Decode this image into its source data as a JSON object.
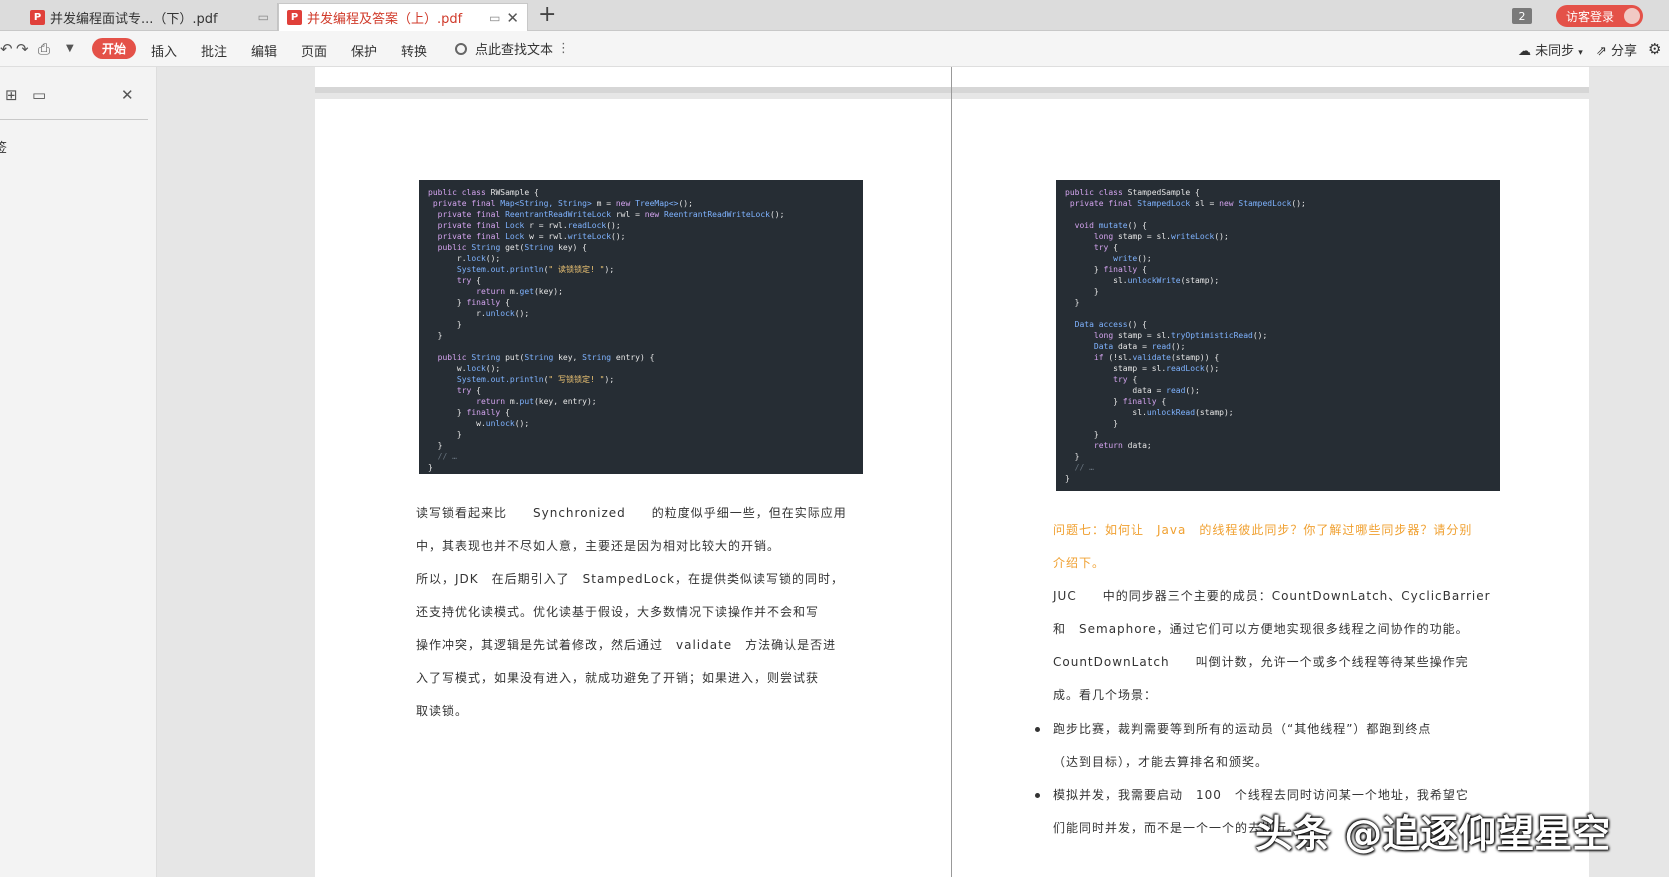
{
  "tabs": [
    {
      "label": "并发编程面试专...（下）.pdf",
      "icon": "pdf-icon"
    },
    {
      "label": "并发编程及答案（上）.pdf",
      "icon": "pdf-icon"
    }
  ],
  "tab_count": "2",
  "login_label": "访客登录",
  "menu": {
    "start": "开始",
    "insert": "插入",
    "annotate": "批注",
    "edit": "编辑",
    "page": "页面",
    "protect": "保护",
    "convert": "转换"
  },
  "search_label": "点此查找文本",
  "sync_label": "未同步",
  "share_label": "分享",
  "side_label": "签",
  "code_left": [
    [
      [
        "kw",
        "public class "
      ],
      [
        "",
        "RWSample {"
      ]
    ],
    [
      [
        "kw",
        " private final "
      ],
      [
        "ty",
        "Map<String, String>"
      ],
      [
        "",
        " m = "
      ],
      [
        "kw",
        "new "
      ],
      [
        "ty",
        "TreeMap<>"
      ],
      [
        "",
        "();"
      ]
    ],
    [
      [
        "kw",
        "  private final "
      ],
      [
        "ty",
        "ReentrantReadWriteLock"
      ],
      [
        "",
        " rwl = "
      ],
      [
        "kw",
        "new "
      ],
      [
        "ty",
        "ReentrantReadWriteLock"
      ],
      [
        "",
        "();"
      ]
    ],
    [
      [
        "kw",
        "  private final "
      ],
      [
        "ty",
        "Lock"
      ],
      [
        "",
        " r = rwl."
      ],
      [
        "ty",
        "readLock"
      ],
      [
        "",
        "();"
      ]
    ],
    [
      [
        "kw",
        "  private final "
      ],
      [
        "ty",
        "Lock"
      ],
      [
        "",
        " w = rwl."
      ],
      [
        "ty",
        "writeLock"
      ],
      [
        "",
        "();"
      ]
    ],
    [
      [
        "kw",
        "  public "
      ],
      [
        "ty",
        "String"
      ],
      [
        "",
        " get("
      ],
      [
        "ty",
        "String"
      ],
      [
        "",
        " key) {"
      ]
    ],
    [
      [
        "",
        "      r."
      ],
      [
        "ty",
        "lock"
      ],
      [
        "",
        "();"
      ]
    ],
    [
      [
        "ty",
        "      System.out.println"
      ],
      [
        "",
        "("
      ],
      [
        "str",
        "\" 读锁锁定! \""
      ],
      [
        "",
        "); "
      ]
    ],
    [
      [
        "kw",
        "      try"
      ],
      [
        "",
        " {"
      ]
    ],
    [
      [
        "kw",
        "          return "
      ],
      [
        "",
        "m."
      ],
      [
        "ty",
        "get"
      ],
      [
        "",
        "(key);"
      ]
    ],
    [
      [
        "",
        "      } "
      ],
      [
        "kw",
        "finally"
      ],
      [
        "",
        " {"
      ]
    ],
    [
      [
        "",
        "          r."
      ],
      [
        "ty",
        "unlock"
      ],
      [
        "",
        "();"
      ]
    ],
    [
      [
        "",
        "      }"
      ]
    ],
    [
      [
        "",
        "  }"
      ]
    ],
    [
      [
        "",
        ""
      ]
    ],
    [
      [
        "kw",
        "  public "
      ],
      [
        "ty",
        "String"
      ],
      [
        "",
        " put("
      ],
      [
        "ty",
        "String"
      ],
      [
        "",
        " key, "
      ],
      [
        "ty",
        "String"
      ],
      [
        "",
        " entry) {"
      ]
    ],
    [
      [
        "",
        "      w."
      ],
      [
        "ty",
        "lock"
      ],
      [
        "",
        "();"
      ]
    ],
    [
      [
        "ty",
        "      System.out.println"
      ],
      [
        "",
        "("
      ],
      [
        "str",
        "\" 写锁锁定! \""
      ],
      [
        "",
        "); "
      ]
    ],
    [
      [
        "kw",
        "      try"
      ],
      [
        "",
        " {"
      ]
    ],
    [
      [
        "kw",
        "          return "
      ],
      [
        "",
        "m."
      ],
      [
        "ty",
        "put"
      ],
      [
        "",
        "(key, entry);"
      ]
    ],
    [
      [
        "",
        "      } "
      ],
      [
        "kw",
        "finally"
      ],
      [
        "",
        " {"
      ]
    ],
    [
      [
        "",
        "          w."
      ],
      [
        "ty",
        "unlock"
      ],
      [
        "",
        "();"
      ]
    ],
    [
      [
        "",
        "      }"
      ]
    ],
    [
      [
        "",
        "  }"
      ]
    ],
    [
      [
        "cm",
        "  // …"
      ]
    ],
    [
      [
        "",
        "}"
      ]
    ]
  ],
  "code_right": [
    [
      [
        "kw",
        "public class "
      ],
      [
        "",
        "StampedSample {"
      ]
    ],
    [
      [
        "kw",
        " private final "
      ],
      [
        "ty",
        "StampedLock"
      ],
      [
        "",
        " sl = "
      ],
      [
        "kw",
        "new "
      ],
      [
        "ty",
        "StampedLock"
      ],
      [
        "",
        "();"
      ]
    ],
    [
      [
        "",
        ""
      ]
    ],
    [
      [
        "kw",
        "  void "
      ],
      [
        "ty",
        "mutate"
      ],
      [
        "",
        "() {"
      ]
    ],
    [
      [
        "kw",
        "      long "
      ],
      [
        "",
        "stamp = sl."
      ],
      [
        "ty",
        "writeLock"
      ],
      [
        "",
        "();"
      ]
    ],
    [
      [
        "kw",
        "      try"
      ],
      [
        "",
        " {"
      ]
    ],
    [
      [
        "ty",
        "          write"
      ],
      [
        "",
        "();"
      ]
    ],
    [
      [
        "",
        "      } "
      ],
      [
        "kw",
        "finally"
      ],
      [
        "",
        " {"
      ]
    ],
    [
      [
        "",
        "          sl."
      ],
      [
        "ty",
        "unlockWrite"
      ],
      [
        "",
        "(stamp);"
      ]
    ],
    [
      [
        "",
        "      }"
      ]
    ],
    [
      [
        "",
        "  }"
      ]
    ],
    [
      [
        "",
        ""
      ]
    ],
    [
      [
        "ty",
        "  Data "
      ],
      [
        "ty",
        "access"
      ],
      [
        "",
        "() {"
      ]
    ],
    [
      [
        "kw",
        "      long "
      ],
      [
        "",
        "stamp = sl."
      ],
      [
        "ty",
        "tryOptimisticRead"
      ],
      [
        "",
        "();"
      ]
    ],
    [
      [
        "ty",
        "      Data "
      ],
      [
        "",
        "data = "
      ],
      [
        "ty",
        "read"
      ],
      [
        "",
        "();"
      ]
    ],
    [
      [
        "kw",
        "      if "
      ],
      [
        "",
        "(!sl."
      ],
      [
        "ty",
        "validate"
      ],
      [
        "",
        "(stamp)) {"
      ]
    ],
    [
      [
        "",
        "          stamp = sl."
      ],
      [
        "ty",
        "readLock"
      ],
      [
        "",
        "();"
      ]
    ],
    [
      [
        "kw",
        "          try"
      ],
      [
        "",
        " {"
      ]
    ],
    [
      [
        "",
        "              data = "
      ],
      [
        "ty",
        "read"
      ],
      [
        "",
        "();"
      ]
    ],
    [
      [
        "",
        "          } "
      ],
      [
        "kw",
        "finally"
      ],
      [
        "",
        " {"
      ]
    ],
    [
      [
        "",
        "              sl."
      ],
      [
        "ty",
        "unlockRead"
      ],
      [
        "",
        "(stamp);"
      ]
    ],
    [
      [
        "",
        "          }"
      ]
    ],
    [
      [
        "",
        "      }"
      ]
    ],
    [
      [
        "kw",
        "      return "
      ],
      [
        "",
        "data;"
      ]
    ],
    [
      [
        "",
        "  }"
      ]
    ],
    [
      [
        "cm",
        "  // …"
      ]
    ],
    [
      [
        "",
        "}"
      ]
    ]
  ],
  "left_text": [
    "读写锁看起来比　　Synchronized　　的粒度似乎细一些，但在实际应用",
    "中，其表现也并不尽如人意，主要还是因为相对比较大的开销。",
    "所以，JDK　在后期引入了　StampedLock，在提供类似读写锁的同时，",
    "还支持优化读模式。优化读基于假设，大多数情况下读操作并不会和写",
    "操作冲突，其逻辑是先试着修改，然后通过　validate　方法确认是否进",
    "入了写模式，如果没有进入，就成功避免了开销；如果进入，则尝试获",
    "取读锁。"
  ],
  "right_title": [
    "问题七：如何让　Java　的线程彼此同步？你了解过哪些同步器？请分别",
    "介绍下。"
  ],
  "right_text": [
    "JUC　　中的同步器三个主要的成员：CountDownLatch、CyclicBarrier",
    "和　Semaphore，通过它们可以方便地实现很多线程之间协作的功能。",
    "CountDownLatch　　叫倒计数，允许一个或多个线程等待某些操作完",
    "成。看几个场景："
  ],
  "bullets": [
    [
      "跑步比赛，裁判需要等到所有的运动员（“其他线程”）都跑到终点",
      "（达到目标），才能去算排名和颁奖。"
    ],
    [
      "模拟并发，我需要启动　100　个线程去同时访问某一个地址，我希望它",
      "们能同时并发，而不是一个一个的去执行。"
    ]
  ],
  "watermark": "头条 @追逐仰望星空"
}
